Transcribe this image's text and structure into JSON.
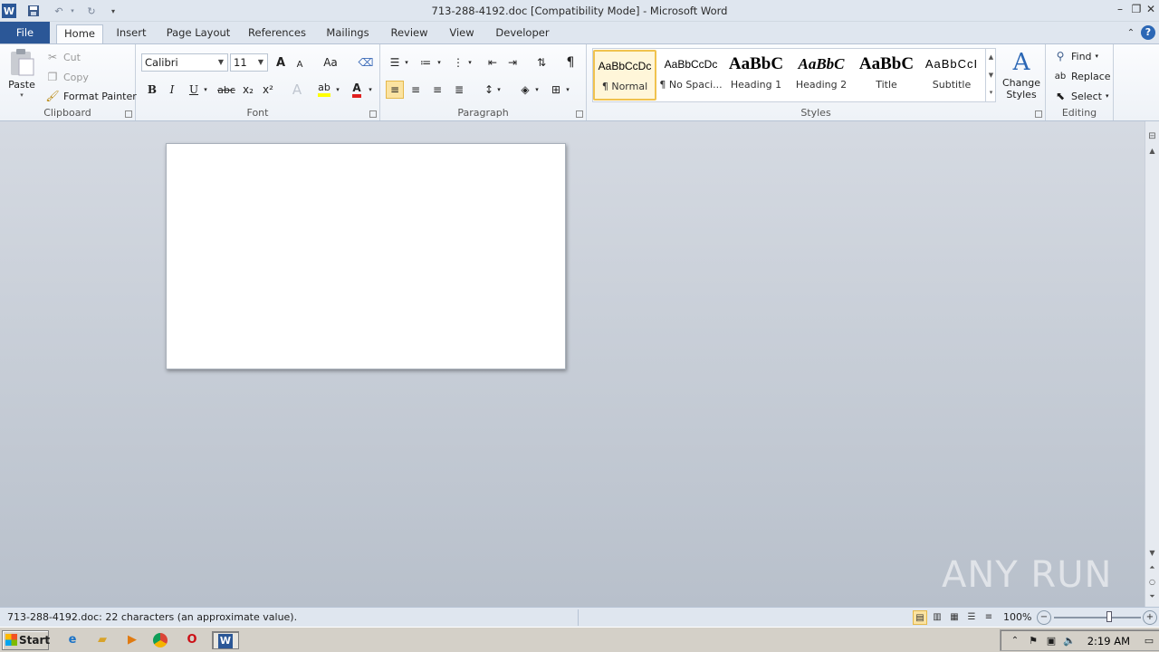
{
  "titlebar": {
    "title": "713-288-4192.doc [Compatibility Mode]  -  Microsoft Word",
    "app_icon": "W",
    "qat": [
      "save-icon",
      "undo-icon",
      "redo-icon",
      "customize-qat-icon"
    ]
  },
  "tabs": [
    "File",
    "Home",
    "Insert",
    "Page Layout",
    "References",
    "Mailings",
    "Review",
    "View",
    "Developer"
  ],
  "active_tab": "Home",
  "ribbon": {
    "clipboard": {
      "label": "Clipboard",
      "paste": "Paste",
      "cut": "Cut",
      "copy": "Copy",
      "format_painter": "Format Painter"
    },
    "font": {
      "label": "Font",
      "font_name": "Calibri",
      "font_size": "11",
      "bold": "B",
      "italic": "I",
      "underline": "U",
      "strike": "abc",
      "subscript": "x₂",
      "superscript": "x²",
      "change_case": "Aa",
      "grow": "A",
      "shrink": "A",
      "font_color": "A",
      "highlight_color": "#ffff00",
      "font_color_hex": "#e02020"
    },
    "paragraph": {
      "label": "Paragraph",
      "pilcrow": "¶"
    },
    "styles": {
      "label": "Styles",
      "items": [
        {
          "preview": "AaBbCcDc",
          "name": "¶ Normal"
        },
        {
          "preview": "AaBbCcDc",
          "name": "¶ No Spaci..."
        },
        {
          "preview": "AaBbC",
          "name": "Heading 1"
        },
        {
          "preview": "AaBbC",
          "name": "Heading 2"
        },
        {
          "preview": "AaBbC",
          "name": "Title"
        },
        {
          "preview": "AaBbCcI",
          "name": "Subtitle"
        }
      ],
      "change_styles": "Change",
      "change_styles_2": "Styles"
    },
    "editing": {
      "label": "Editing",
      "find": "Find",
      "replace": "Replace",
      "select": "Select"
    }
  },
  "status": {
    "text": "713-288-4192.doc: 22 characters (an approximate value).",
    "zoom": "100%",
    "zoom_level": 1.0
  },
  "watermark": "ANY RUN",
  "taskbar": {
    "start": "Start",
    "clock": "2:19 AM"
  },
  "colors": {
    "file_tab": "#2b5797",
    "selected_style": "#f0c24e",
    "workspace": "#c4cad3"
  }
}
